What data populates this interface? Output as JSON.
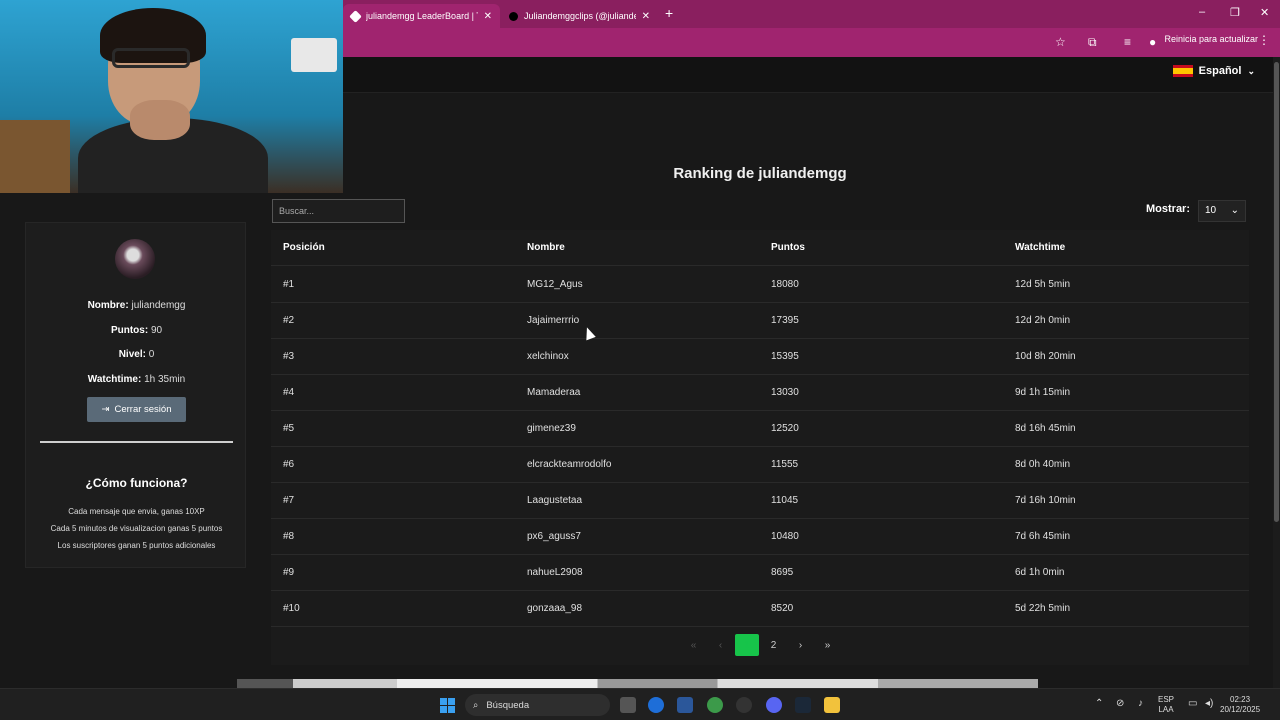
{
  "browser": {
    "tabs": [
      {
        "title": "juliandemgg LeaderBoard | The"
      },
      {
        "title": "Juliandemggclips (@juliandem"
      }
    ],
    "update_label": "Reinicia para actualizar"
  },
  "nav": {
    "language": "Español"
  },
  "page": {
    "title": "Ranking de juliandemgg",
    "search_placeholder": "Buscar...",
    "show_label": "Mostrar:",
    "show_value": "10"
  },
  "profile": {
    "name_label": "Nombre:",
    "name": "juliandemgg",
    "points_label": "Puntos:",
    "points": "90",
    "level_label": "Nivel:",
    "level": "0",
    "watchtime_label": "Watchtime:",
    "watchtime": "1h 35min",
    "logout_label": "Cerrar sesión"
  },
  "how": {
    "title": "¿Cómo funciona?",
    "rules": [
      "Cada mensaje que envia, ganas 10XP",
      "Cada 5 minutos de visualizacion ganas 5 puntos",
      "Los suscriptores ganan 5 puntos adicionales"
    ]
  },
  "table": {
    "headers": [
      "Posición",
      "Nombre",
      "Puntos",
      "Watchtime"
    ],
    "rows": [
      [
        "#1",
        "MG12_Agus",
        "18080",
        "12d 5h 5min"
      ],
      [
        "#2",
        "Jajaimerrrio",
        "17395",
        "12d 2h 0min"
      ],
      [
        "#3",
        "xelchinox",
        "15395",
        "10d 8h 20min"
      ],
      [
        "#4",
        "Mamaderaa",
        "13030",
        "9d 1h 15min"
      ],
      [
        "#5",
        "gimenez39",
        "12520",
        "8d 16h 45min"
      ],
      [
        "#6",
        "elcrackteamrodolfo",
        "11555",
        "8d 0h 40min"
      ],
      [
        "#7",
        "Laagustetaa",
        "11045",
        "7d 16h 10min"
      ],
      [
        "#8",
        "px6_aguss7",
        "10480",
        "7d 6h 45min"
      ],
      [
        "#9",
        "nahueL2908",
        "8695",
        "6d 1h 0min"
      ],
      [
        "#10",
        "gonzaaa_98",
        "8520",
        "5d 22h 5min"
      ]
    ]
  },
  "pagination": {
    "first": "«",
    "prev": "‹",
    "pages": [
      "1",
      "2"
    ],
    "next": "›",
    "last": "»",
    "current": "1"
  },
  "taskbar": {
    "search_label": "Búsqueda",
    "lang_top": "ESP",
    "lang_bottom": "LAA",
    "time": "02:23",
    "date": "20/12/2025"
  },
  "colors": {
    "tab_accent": "#a0246f",
    "page_bg": "#181818",
    "current_page": "#17c44a",
    "logout_btn": "#5a6a78"
  }
}
